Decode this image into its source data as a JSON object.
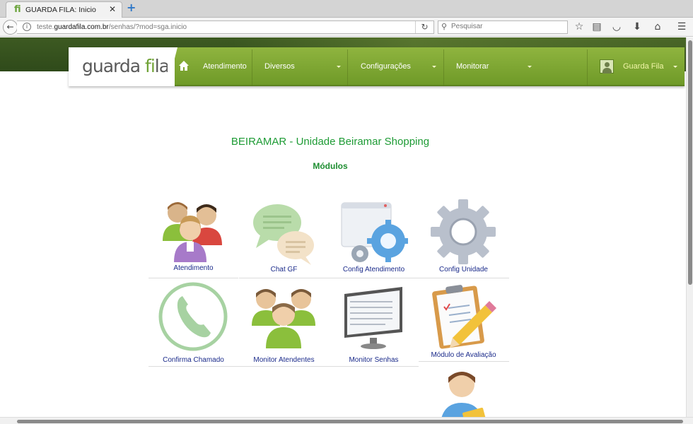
{
  "browser": {
    "tab_title": "GUARDA FILA: Inicio",
    "tab_favicon": "fi",
    "url_prefix": "teste.",
    "url_domain": "guardafila.com.br",
    "url_path": "/senhas/?mod=sga.inicio",
    "search_placeholder": "Pesquisar"
  },
  "header": {
    "logo_part1": "guarda ",
    "logo_part2": "fi",
    "logo_part3": "la",
    "menu": [
      {
        "label": "Atendimento"
      },
      {
        "label": "Diversos"
      },
      {
        "label": "Configurações"
      },
      {
        "label": "Monitorar"
      }
    ],
    "user_name": "Guarda Fila"
  },
  "main": {
    "unit_title": "BEIRAMAR - Unidade Beiramar Shopping",
    "modules_title": "Módulos",
    "modules": [
      {
        "label": "Atendimento",
        "icon": "users-group-icon"
      },
      {
        "label": "Chat GF",
        "icon": "chat-bubbles-icon"
      },
      {
        "label": "Config Atendimento",
        "icon": "window-gear-icon"
      },
      {
        "label": "Config Unidade",
        "icon": "gear-icon"
      },
      {
        "label": "Confirma Chamado",
        "icon": "phone-circle-icon"
      },
      {
        "label": "Monitor Atendentes",
        "icon": "attendants-group-icon"
      },
      {
        "label": "Monitor Senhas",
        "icon": "monitor-screen-icon"
      },
      {
        "label": "Módulo de Avaliação",
        "icon": "clipboard-pencil-icon"
      },
      {
        "label": "",
        "icon": "user-ticket-icon"
      }
    ]
  },
  "colors": {
    "brand_green": "#6f9a28",
    "title_green": "#1e9b35",
    "label_blue": "#1a2a8a"
  }
}
